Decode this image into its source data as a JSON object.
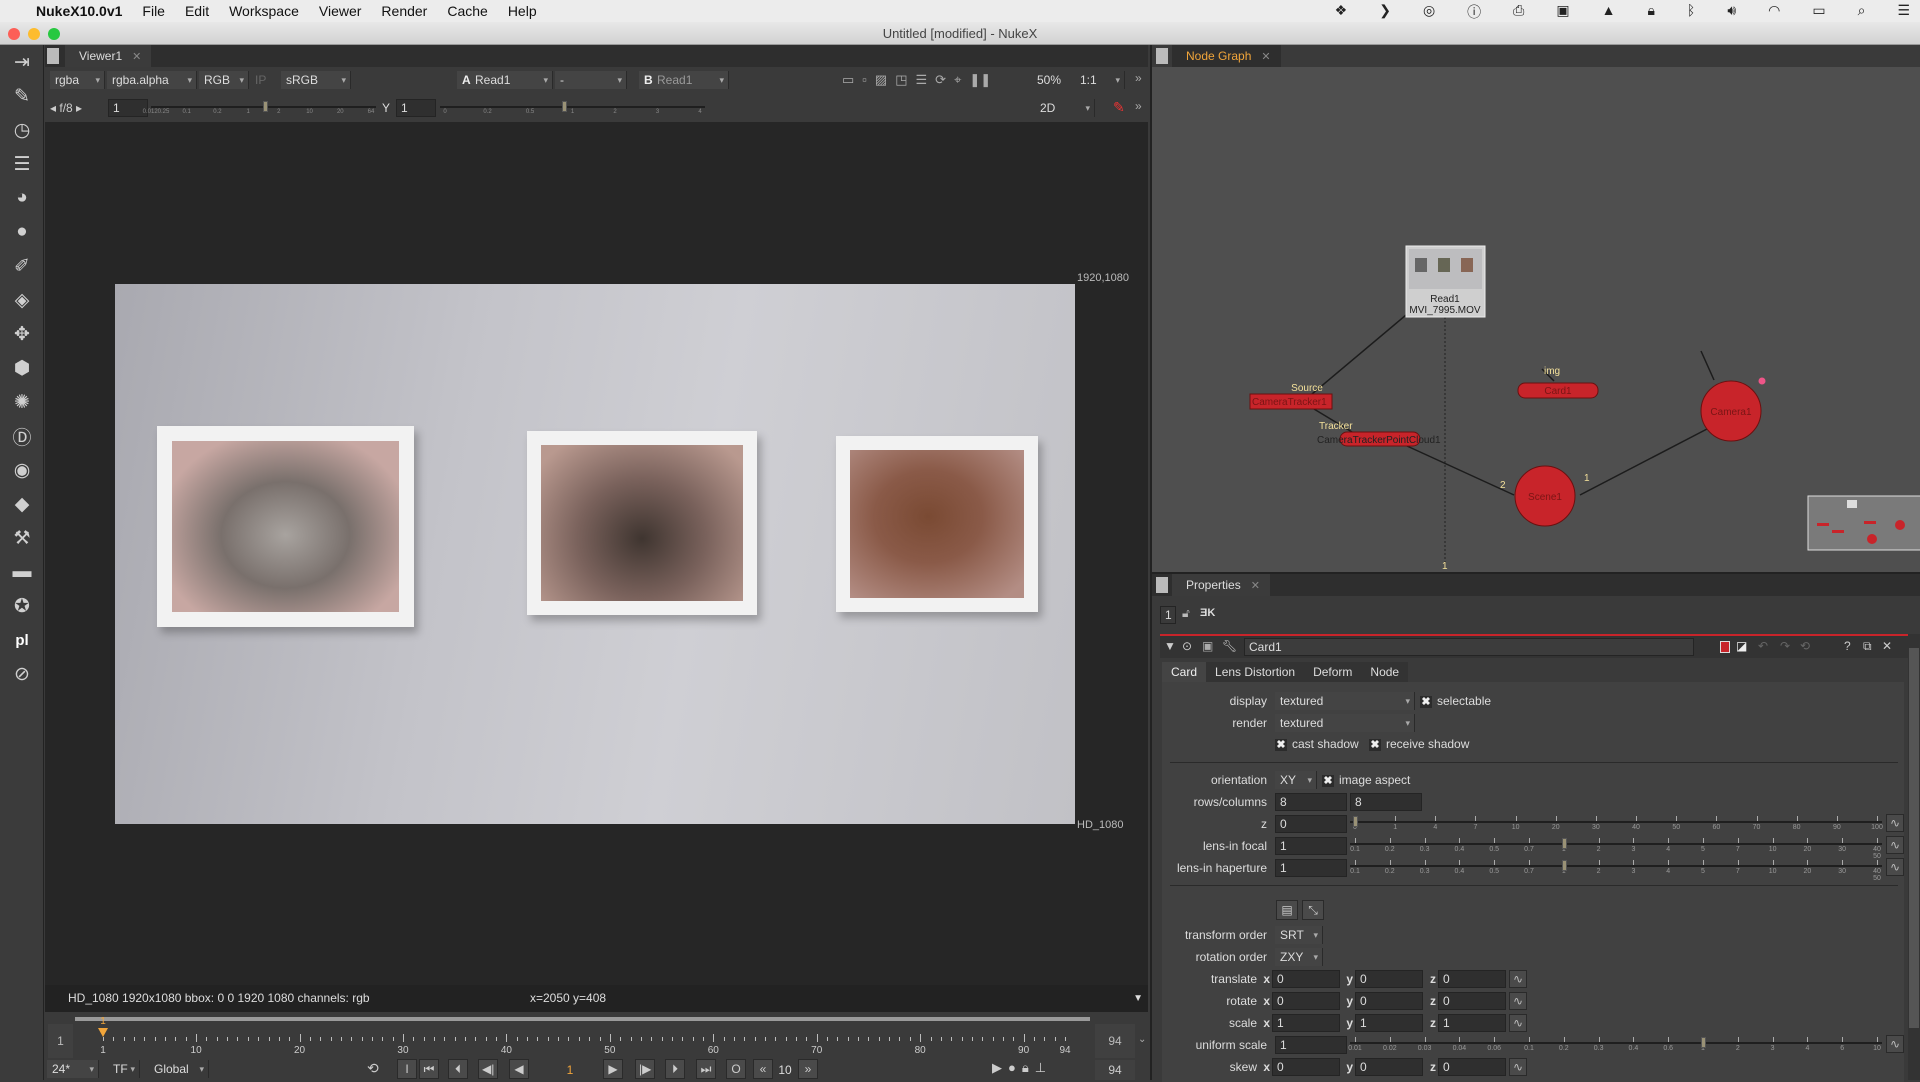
{
  "menubar": {
    "app": "NukeX10.0v1",
    "items": [
      "File",
      "Edit",
      "Workspace",
      "Viewer",
      "Render",
      "Cache",
      "Help"
    ]
  },
  "window": {
    "title": "Untitled [modified] - NukeX"
  },
  "left_toolbar": [
    "viewer-input-icon",
    "draw-icon",
    "time-icon",
    "channel-icon",
    "color-icon",
    "filter-icon",
    "keyer-icon",
    "merge-icon",
    "transform-icon",
    "3d-icon",
    "particles-icon",
    "deep-icon",
    "views-icon",
    "metadata-icon",
    "toolsets-icon",
    "other-icon",
    "furnace-icon",
    "pl-icon",
    "ofx-icon"
  ],
  "viewer": {
    "tab": "Viewer1",
    "channels": "rgba",
    "alpha": "rgba.alpha",
    "display_channel": "RGB",
    "ip": "IP",
    "lut": "sRGB",
    "a_label": "A",
    "a_input": "Read1",
    "op": "-",
    "b_label": "B",
    "b_input": "Read1",
    "zoom": "50%",
    "ratio": "1:1",
    "fstop": "f/8",
    "gain": "1",
    "gain_ticks": [
      "0.0120.25",
      "0.1",
      "0.2",
      "1",
      "2",
      "10",
      "20",
      "64"
    ],
    "gamma_label": "Y",
    "gamma": "1",
    "gamma_ticks": [
      "0",
      "0.2",
      "0.5",
      "1",
      "2",
      "3",
      "4"
    ],
    "mode": "2D",
    "format_top_right": "1920,1080",
    "format_bottom_right": "HD_1080",
    "info": "HD_1080 1920x1080  bbox: 0 0 1920 1080 channels: rgb",
    "coords": "x=2050 y=408"
  },
  "timeline": {
    "start": "1",
    "end": "94",
    "current": "1",
    "marker": "1",
    "tick_labels": [
      "1",
      "10",
      "20",
      "30",
      "40",
      "50",
      "60",
      "70",
      "80",
      "90",
      "94"
    ],
    "fps": "24*",
    "tf": "TF",
    "scope": "Global",
    "step": "10",
    "in_label": "I",
    "out_label": "O",
    "end_frame": "94"
  },
  "node_graph": {
    "tab": "Node Graph",
    "nodes": {
      "read": "Read1",
      "read_file": "MVI_7995.MOV",
      "tracker": "CameraTracker1",
      "pointcloud": "CameraTrackerPointCloud1",
      "card": "Card1",
      "camera": "Camera1",
      "scene": "Scene1"
    },
    "edge_labels": {
      "source": "Source",
      "tracker": "Tracker",
      "img": "img",
      "scene_in2": "2",
      "scene_in1": "1",
      "frame": "1"
    }
  },
  "properties": {
    "tab": "Properties",
    "max_panels": "1",
    "node_name": "Card1",
    "tabs": [
      "Card",
      "Lens Distortion",
      "Deform",
      "Node"
    ],
    "display": {
      "label": "display",
      "value": "textured"
    },
    "selectable": "selectable",
    "render": {
      "label": "render",
      "value": "textured"
    },
    "cast_shadow": "cast shadow",
    "receive_shadow": "receive shadow",
    "orientation": {
      "label": "orientation",
      "value": "XY"
    },
    "image_aspect": "image aspect",
    "rows_columns": {
      "label": "rows/columns",
      "rows": "8",
      "columns": "8"
    },
    "z": {
      "label": "z",
      "value": "0",
      "ticks": [
        "0",
        "1",
        "4",
        "7",
        "10",
        "20",
        "30",
        "40",
        "50",
        "60",
        "70",
        "80",
        "90",
        "100"
      ]
    },
    "lens_in_focal": {
      "label": "lens-in focal",
      "value": "1",
      "ticks": [
        "0.1",
        "0.2",
        "0.3",
        "0.4",
        "0.5",
        "0.7",
        "1",
        "2",
        "3",
        "4",
        "5",
        "7",
        "10",
        "20",
        "30",
        "40 50"
      ]
    },
    "lens_in_haperture": {
      "label": "lens-in haperture",
      "value": "1",
      "ticks": [
        "0.1",
        "0.2",
        "0.3",
        "0.4",
        "0.5",
        "0.7",
        "1",
        "2",
        "3",
        "4",
        "5",
        "7",
        "10",
        "20",
        "30",
        "40 50"
      ]
    },
    "transform_order": {
      "label": "transform order",
      "value": "SRT"
    },
    "rotation_order": {
      "label": "rotation order",
      "value": "ZXY"
    },
    "translate": {
      "label": "translate",
      "x": "0",
      "y": "0",
      "z": "0"
    },
    "rotate": {
      "label": "rotate",
      "x": "0",
      "y": "0",
      "z": "0"
    },
    "scale": {
      "label": "scale",
      "x": "1",
      "y": "1",
      "z": "1"
    },
    "uniform_scale": {
      "label": "uniform scale",
      "value": "1",
      "ticks": [
        "0.01",
        "0.02",
        "0.03",
        "0.04",
        "0.06",
        "0.1",
        "0.2",
        "0.3",
        "0.4",
        "0.6",
        "1",
        "2",
        "3",
        "4",
        "6",
        "10"
      ]
    },
    "skew": {
      "label": "skew",
      "x": "0",
      "y": "0",
      "z": "0"
    },
    "axis": {
      "x": "x",
      "y": "y",
      "z": "z"
    }
  },
  "colors": {
    "node_red": "#c8242a",
    "accent_orange": "#f1a53a",
    "panel": "#3a3a3a",
    "viewer_bg": "#262626"
  }
}
